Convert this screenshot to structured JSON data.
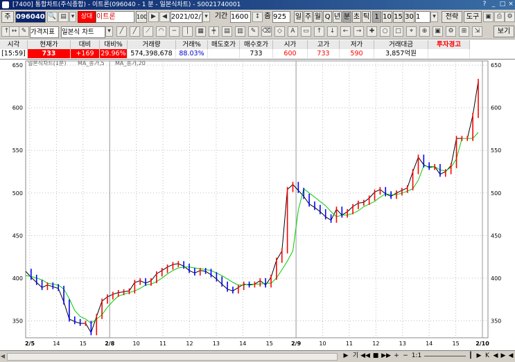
{
  "window": {
    "title": "[7400] 통합차트(주식종합) - 이트론(096040 - 1 분 - 일본식차트) - S0021740001"
  },
  "toolbar": {
    "market_code": "주",
    "stock_code": "096040",
    "stock_name": "이트론",
    "stock_tag": "상대",
    "count_badge": "100",
    "date": "2021/02/10",
    "period_label": "기간",
    "period_value": "1600",
    "zoom_label": "줌",
    "zoom_value": "925",
    "day": "일",
    "week": "주",
    "month": "월",
    "q": "Q",
    "year": "년",
    "minute": "분",
    "second": "초",
    "tick": "틱",
    "interval_1": "1",
    "interval_10": "10",
    "interval_15": "15",
    "interval_30": "30",
    "interval_select": "1",
    "strategy": "전략",
    "tools": "도구",
    "indicator_select": "가격지표",
    "chart_type_select": "일본식 차트",
    "view": "보기"
  },
  "quote": {
    "headers": [
      "시각",
      "현재가",
      "대비",
      "대비%",
      "거래량",
      "거래%",
      "매도호가",
      "매수호가",
      "시가",
      "고가",
      "저가",
      "거래대금",
      "투자경고"
    ],
    "values": [
      "[15:59]",
      "733",
      "+169",
      "29.96%",
      "574,398,678",
      "88.03%",
      "",
      "733",
      "600",
      "733",
      "590",
      "3,857억원",
      ""
    ]
  },
  "colors": {
    "up": "#ff0000",
    "down": "#0000ff",
    "ma5": "#000000",
    "ma20": "#00cc00",
    "badge_bg": "#ff0000"
  },
  "chart_data": {
    "type": "line",
    "legend": [
      "일본식차트(1분)",
      "MA_종가,5",
      "MA_종가,20"
    ],
    "ylim": [
      330,
      655
    ],
    "y_ticks": [
      350,
      400,
      450,
      500,
      550,
      600,
      650
    ],
    "x_ticks": [
      "2/5",
      "14",
      "15",
      "2/8",
      "10",
      "11",
      "12",
      "13",
      "14",
      "15",
      "2/9",
      "10",
      "11",
      "12",
      "13",
      "14",
      "15",
      "2/10"
    ],
    "day_separators": [
      "2/8",
      "2/9",
      "2/10"
    ],
    "grid": true,
    "series": [
      {
        "name": "MA_종가,5",
        "values": [
          408,
          401,
          395,
          389,
          392,
          390,
          388,
          372,
          352,
          349,
          347,
          347,
          336,
          355,
          373,
          378,
          381,
          383,
          384,
          385,
          395,
          397,
          394,
          397,
          405,
          409,
          413,
          416,
          417,
          414,
          409,
          406,
          409,
          408,
          404,
          399,
          393,
          387,
          385,
          389,
          393,
          392,
          393,
          397,
          392,
          401,
          421,
          432,
          504,
          510,
          503,
          496,
          487,
          483,
          478,
          472,
          468,
          481,
          474,
          478,
          484,
          488,
          489,
          494,
          501,
          504,
          499,
          496,
          500,
          503,
          506,
          525,
          542,
          533,
          530,
          531,
          522,
          525,
          532,
          564,
          564,
          564,
          591,
          631
        ]
      },
      {
        "name": "MA_종가,20",
        "values": [
          403,
          402,
          400,
          398,
          394,
          393,
          392,
          387,
          376,
          362,
          355,
          352,
          347,
          352,
          357,
          366,
          373,
          379,
          381,
          383,
          385,
          388,
          392,
          393,
          396,
          400,
          405,
          409,
          412,
          413,
          413,
          412,
          411,
          410,
          409,
          406,
          403,
          399,
          395,
          392,
          392,
          393,
          393,
          393,
          394,
          394,
          400,
          410,
          420,
          432,
          480,
          505,
          500,
          495,
          490,
          485,
          478,
          472,
          474,
          474,
          476,
          479,
          484,
          487,
          490,
          495,
          499,
          498,
          498,
          500,
          502,
          505,
          515,
          532,
          531,
          531,
          527,
          526,
          530,
          540,
          564,
          564,
          564,
          571
        ]
      }
    ]
  },
  "bottombar": {
    "labels": [
      "기",
      "◀◀",
      "■",
      "▶▶",
      "+",
      "−",
      "1:1",
      "┃",
      "▶",
      "K",
      "◀",
      "▶",
      "◀"
    ]
  }
}
